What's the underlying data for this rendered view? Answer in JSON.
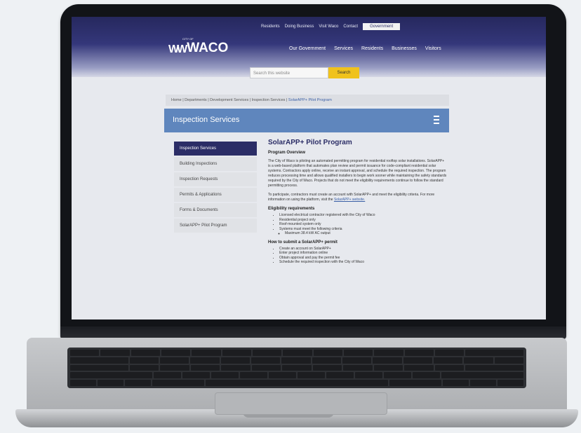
{
  "header": {
    "utility_links": [
      "Residents",
      "Doing Business",
      "Visit Waco",
      "Contact"
    ],
    "utility_button": "Government",
    "logo_small": "CITY OF",
    "logo_text": "WACO",
    "main_nav": [
      "Our Government",
      "Services",
      "Residents",
      "Businesses",
      "Visitors"
    ]
  },
  "search": {
    "placeholder": "Search this website",
    "button": "Search"
  },
  "breadcrumb": {
    "items": [
      "Home",
      "Departments",
      "Development Services",
      "Inspection Services"
    ],
    "current": "SolarAPP+ Pilot Program"
  },
  "banner": {
    "title": "Inspection Services"
  },
  "sidebar": {
    "items": [
      "Inspection Services",
      "Building Inspections",
      "Inspection Requests",
      "Permits & Applications",
      "Forms & Documents",
      "SolarAPP+ Pilot Program"
    ]
  },
  "content": {
    "title": "SolarAPP+ Pilot Program",
    "subtitle": "Program Overview",
    "para1": "The City of Waco is piloting an automated permitting program for residential rooftop solar installations. SolarAPP+ is a web-based platform that automates plan review and permit issuance for code-compliant residential solar systems. Contractors apply online, receive an instant approval, and schedule the required inspection. The program reduces processing time and allows qualified installers to begin work sooner while maintaining the safety standards required by the City of Waco. Projects that do not meet the eligibility requirements continue to follow the standard permitting process.",
    "para2": "To participate, contractors must create an account with SolarAPP+ and meet the eligibility criteria. For more information on using the platform, visit the",
    "para2_link": "SolarAPP+ website.",
    "eligibility_heading": "Eligibility requirements",
    "eligibility_items": [
      "Licensed electrical contractor registered with the City of Waco",
      "Residential project only",
      "Roof-mounted system only",
      "Systems must meet the following criteria",
      "Maximum 38.4 kW AC output"
    ],
    "steps_heading": "How to submit a SolarAPP+ permit",
    "steps_items": [
      "Create an account on SolarAPP+",
      "Enter project information online",
      "Obtain approval and pay the permit fee",
      "Schedule the required inspection with the City of Waco"
    ]
  }
}
